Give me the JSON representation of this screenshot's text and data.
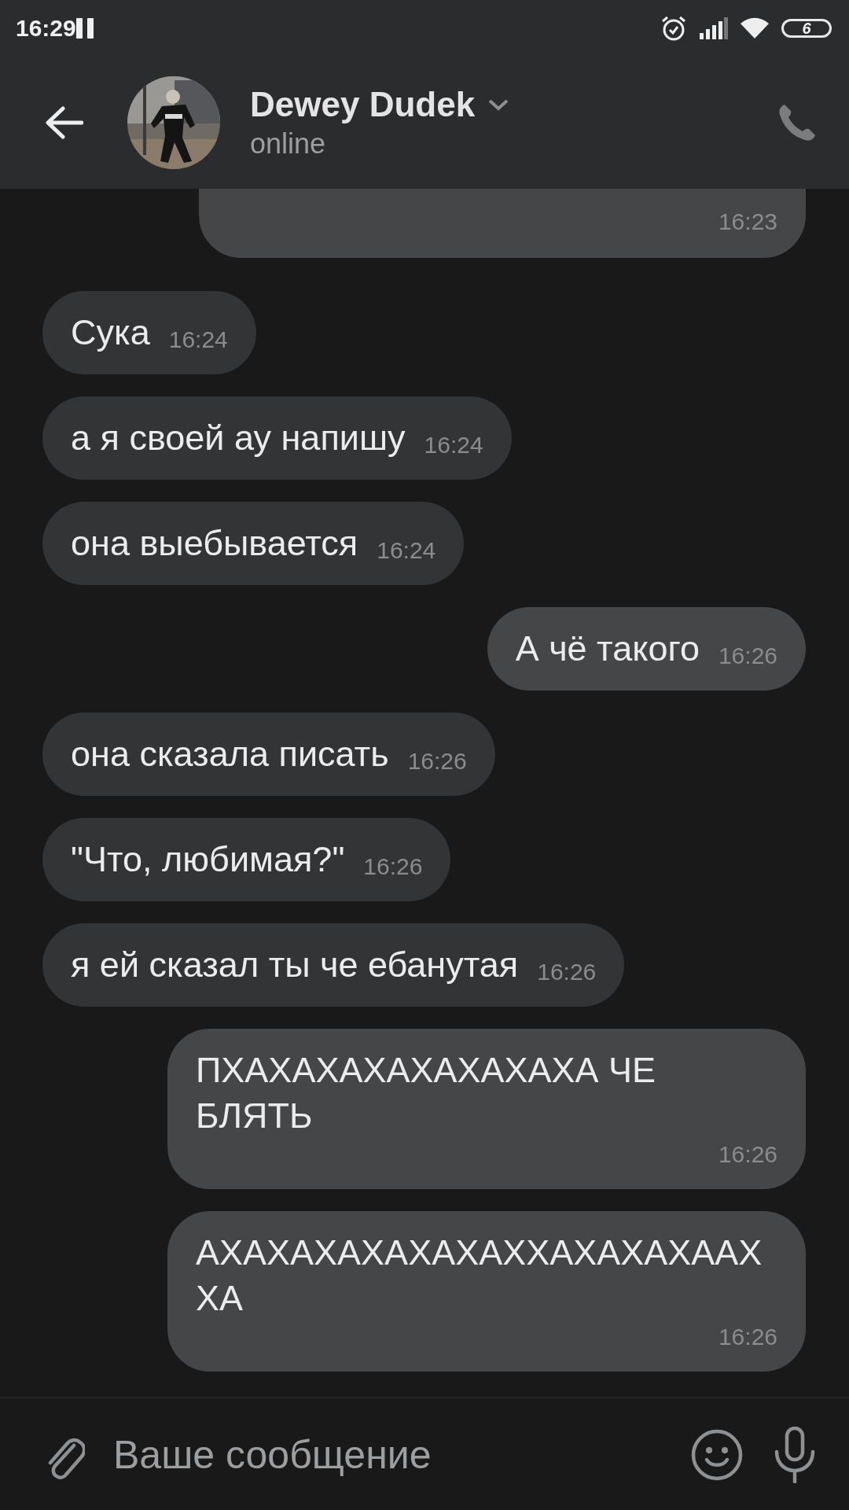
{
  "status_bar": {
    "time": "16:29",
    "battery": "6"
  },
  "header": {
    "name": "Dewey Dudek",
    "status": "online"
  },
  "messages": [
    {
      "kind": "cut",
      "outgoing": true,
      "time": "16:23"
    },
    {
      "kind": "text",
      "outgoing": false,
      "text": "Сука",
      "time": "16:24"
    },
    {
      "kind": "text",
      "outgoing": false,
      "text": "а я своей ау напишу",
      "time": "16:24"
    },
    {
      "kind": "text",
      "outgoing": false,
      "text": "она выебывается",
      "time": "16:24"
    },
    {
      "kind": "text",
      "outgoing": true,
      "text": "А чё такого",
      "time": "16:26"
    },
    {
      "kind": "text",
      "outgoing": false,
      "text": "она сказала писать",
      "time": "16:26"
    },
    {
      "kind": "text",
      "outgoing": false,
      "text": "\"Что, любимая?\"",
      "time": "16:26"
    },
    {
      "kind": "text",
      "outgoing": false,
      "text": "я ей сказал ты че ебанутая",
      "time": "16:26"
    },
    {
      "kind": "text",
      "outgoing": true,
      "text": "ПХАХАХАХАХАХАХАХА ЧЕ БЛЯТЬ",
      "time": "16:26"
    },
    {
      "kind": "text",
      "outgoing": true,
      "text": "АХАХАХАХАХАХАХХАХАХАХААХ ХА",
      "time": "16:26"
    }
  ],
  "composer": {
    "placeholder": "Ваше сообщение"
  }
}
